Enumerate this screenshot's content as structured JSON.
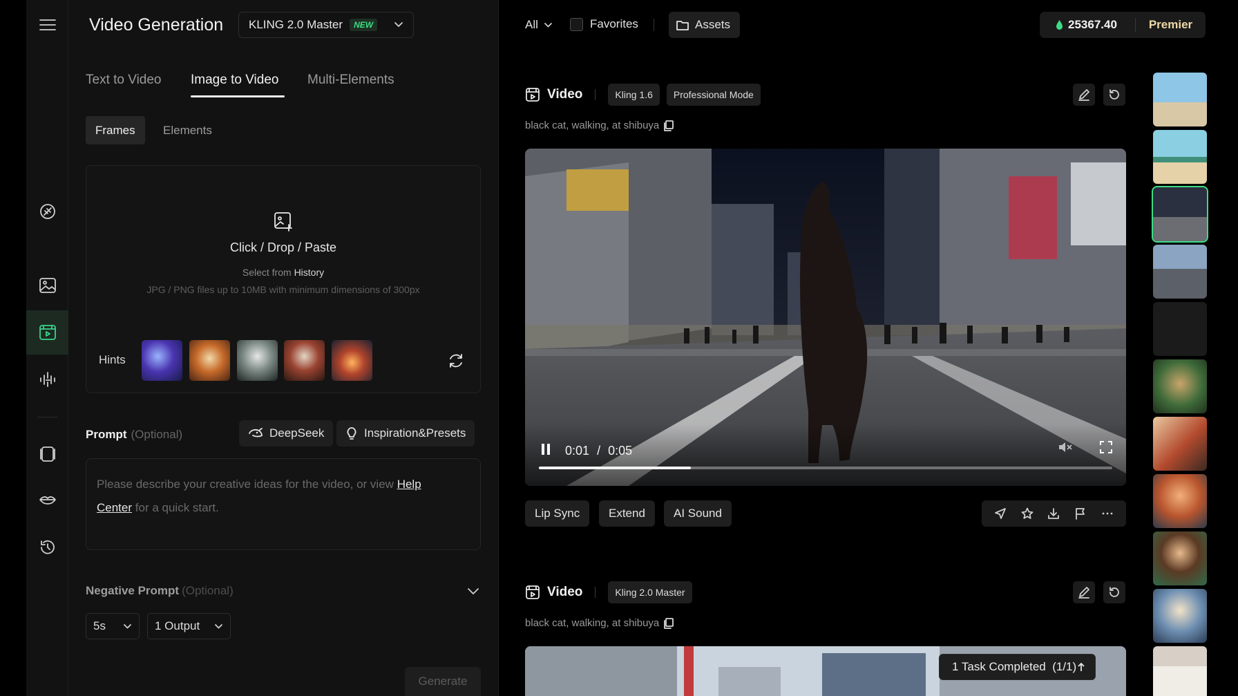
{
  "header": {
    "title": "Video Generation",
    "model": "KLING 2.0 Master",
    "model_badge": "NEW"
  },
  "mode_tabs": [
    "Text to Video",
    "Image to Video",
    "Multi-Elements"
  ],
  "sub_tabs": [
    "Frames",
    "Elements"
  ],
  "upload": {
    "title": "Click / Drop / Paste",
    "select_prefix": "Select from",
    "select_link": "History",
    "note": "JPG / PNG files up to 10MB with minimum dimensions of 300px",
    "hints_label": "Hints"
  },
  "prompt": {
    "label": "Prompt",
    "optional": "(Optional)",
    "deepseek": "DeepSeek",
    "presets": "Inspiration&Presets",
    "placeholder_pre": "Please describe your creative ideas for the video, or view",
    "help_1": "Help",
    "help_2": "Center",
    "placeholder_post": "for a quick start."
  },
  "negative_prompt": {
    "label": "Negative Prompt",
    "optional": "(Optional)"
  },
  "settings": {
    "duration": "5s",
    "outputs": "1 Output"
  },
  "generate_label": "Generate",
  "topbar": {
    "filter": "All",
    "favorites": "Favorites",
    "assets": "Assets",
    "credits": "25367.40",
    "plan": "Premier"
  },
  "cards": [
    {
      "title": "Video",
      "badges": [
        "Kling 1.6",
        "Professional Mode"
      ],
      "caption": "black cat, walking, at shibuya",
      "time_current": "0:01",
      "time_sep": "/",
      "time_total": "0:05",
      "progress": 0.265,
      "actions": [
        "Lip Sync",
        "Extend",
        "AI Sound"
      ]
    },
    {
      "title": "Video",
      "badges": [
        "Kling 2.0 Master"
      ],
      "caption": "black cat, walking, at shibuya"
    }
  ],
  "toast": "1 Task Completed  (1/1)",
  "colors": {
    "accent": "#3ddc84",
    "premium": "#efd9a6",
    "panel": "#121212"
  }
}
